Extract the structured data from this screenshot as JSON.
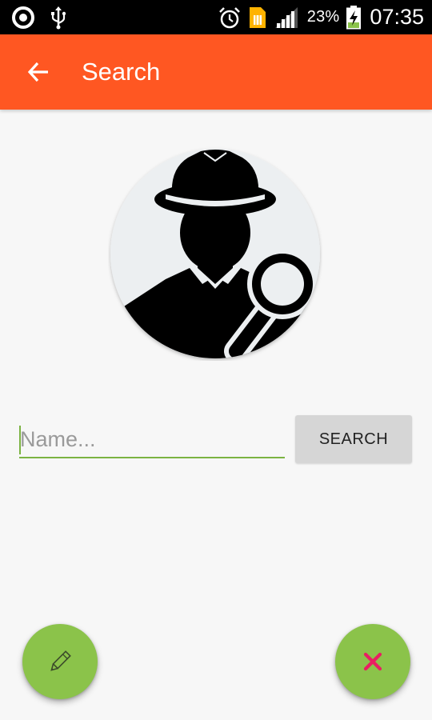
{
  "status_bar": {
    "battery_percent": "23%",
    "time": "07:35",
    "icons": [
      "app-indicator-icon",
      "usb-icon",
      "alarm-icon",
      "sim-card-icon",
      "signal-icon",
      "battery-charging-icon"
    ]
  },
  "app_bar": {
    "title": "Search",
    "back_icon": "arrow-back-icon",
    "color": "#ff5722"
  },
  "avatar": {
    "icon": "detective-search-icon"
  },
  "search": {
    "placeholder": "Name...",
    "value": "",
    "button_label": "SEARCH",
    "accent_color": "#7cb342"
  },
  "fabs": {
    "edit_icon": "pencil-icon",
    "close_icon": "close-icon",
    "color": "#8bc34a",
    "close_icon_color": "#e91e63"
  }
}
